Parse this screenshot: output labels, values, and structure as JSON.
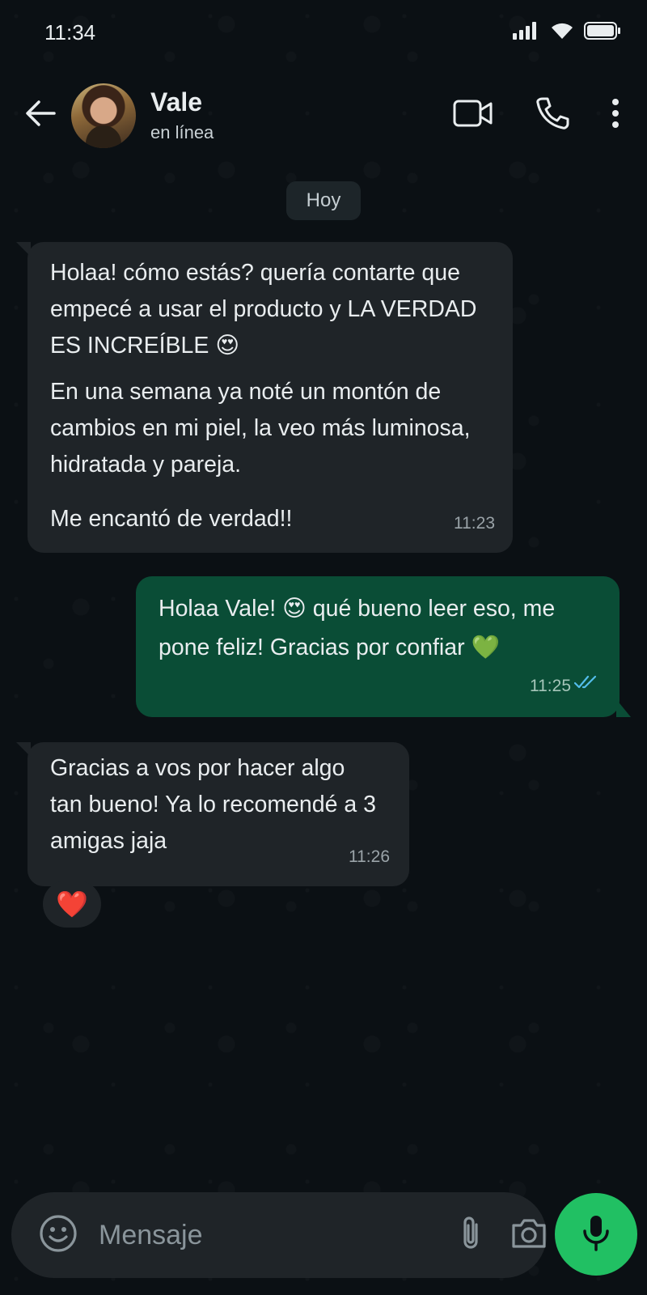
{
  "status_bar": {
    "time": "11:34",
    "icons": [
      "signal-icon",
      "wifi-icon",
      "battery-icon"
    ]
  },
  "header": {
    "contact_name": "Vale",
    "contact_status": "en línea",
    "icons": [
      "back-arrow-icon",
      "video-call-icon",
      "phone-icon",
      "more-vert-icon"
    ]
  },
  "chat": {
    "date_chip": "Hoy",
    "messages": [
      {
        "direction": "incoming",
        "paragraphs": [
          "Holaa! cómo estás? quería contarte que empecé a usar el producto y LA VERDAD ES INCREÍBLE 😍",
          "En una semana ya noté un montón de cambios en mi piel, la veo más luminosa, hidratada y pareja.",
          "Me encantó de verdad!!"
        ],
        "time": "11:23"
      },
      {
        "direction": "outgoing",
        "paragraphs": [
          "Holaa Vale! 😍 qué bueno leer eso, me pone feliz! Gracias por confiar 💚"
        ],
        "time": "11:25",
        "read_receipt": "double-check-blue"
      },
      {
        "direction": "incoming",
        "paragraphs": [
          "Gracias a vos por hacer algo tan bueno! Ya lo recomendé a 3 amigas jaja"
        ],
        "time": "11:26",
        "reaction": "❤️"
      }
    ]
  },
  "input": {
    "placeholder": "Mensaje",
    "icons": [
      "emoji-icon",
      "attach-icon",
      "camera-icon",
      "mic-icon"
    ]
  },
  "colors": {
    "background": "#0b1014",
    "incoming_bubble": "#1f2428",
    "outgoing_bubble": "#0a4d36",
    "accent": "#21c063",
    "read_receipt": "#53bdeb"
  }
}
